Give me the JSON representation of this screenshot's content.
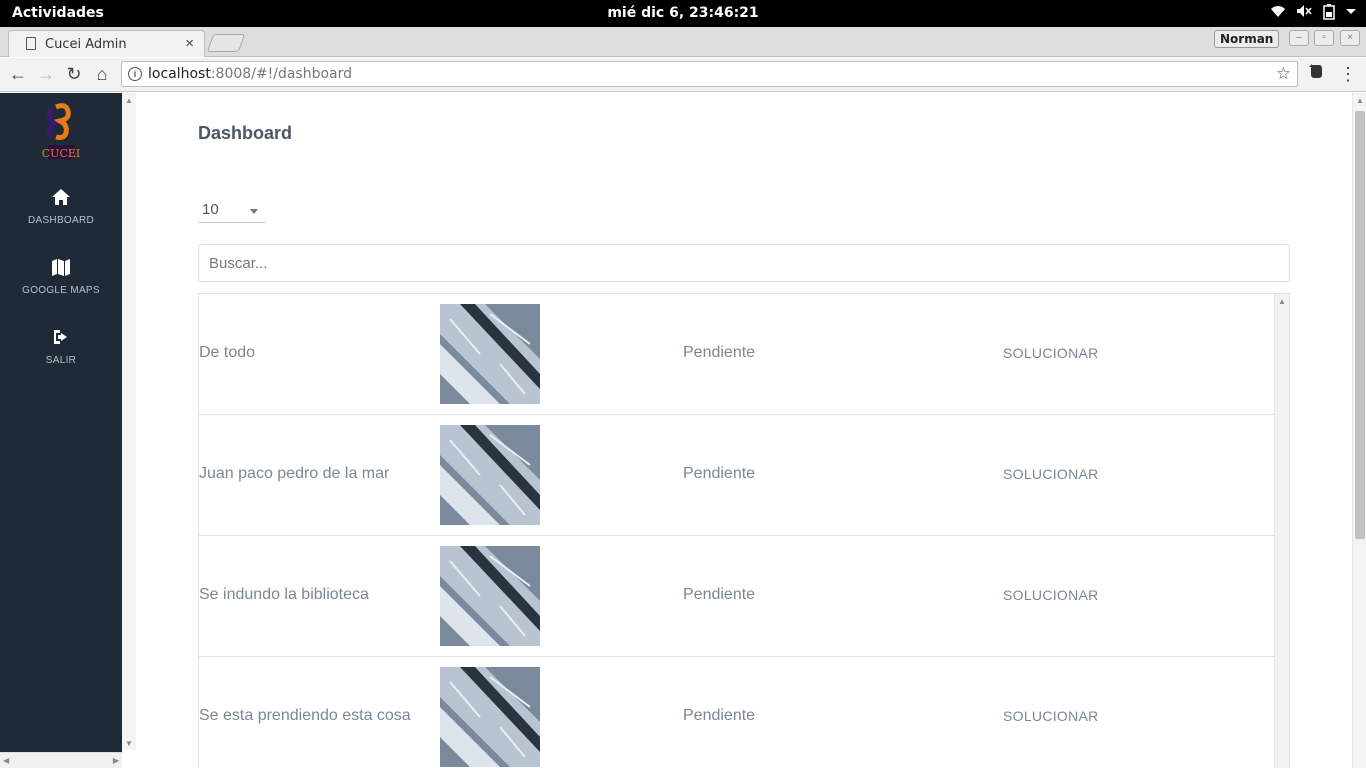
{
  "os": {
    "activities": "Actividades",
    "clock": "mié dic  6, 23:46:21"
  },
  "browser": {
    "tab_title": "Cucei Admin",
    "profile": "Norman",
    "url_host": "localhost",
    "url_rest": ":8008/#!/dashboard"
  },
  "sidebar": {
    "logo_text": "CUCEI",
    "items": [
      {
        "label": "DASHBOARD",
        "icon": "home-icon"
      },
      {
        "label": "GOOGLE MAPS",
        "icon": "map-icon"
      },
      {
        "label": "SALIR",
        "icon": "sign-out-icon"
      }
    ]
  },
  "main": {
    "title": "Dashboard",
    "per_page": "10",
    "search_placeholder": "Buscar...",
    "rows": [
      {
        "name": "De todo",
        "status": "Pendiente",
        "action": "SOLUCIONAR"
      },
      {
        "name": "Juan paco pedro de la mar",
        "status": "Pendiente",
        "action": "SOLUCIONAR"
      },
      {
        "name": "Se indundo la biblioteca",
        "status": "Pendiente",
        "action": "SOLUCIONAR"
      },
      {
        "name": "Se esta prendiendo esta cosa",
        "status": "Pendiente",
        "action": "SOLUCIONAR"
      }
    ]
  }
}
